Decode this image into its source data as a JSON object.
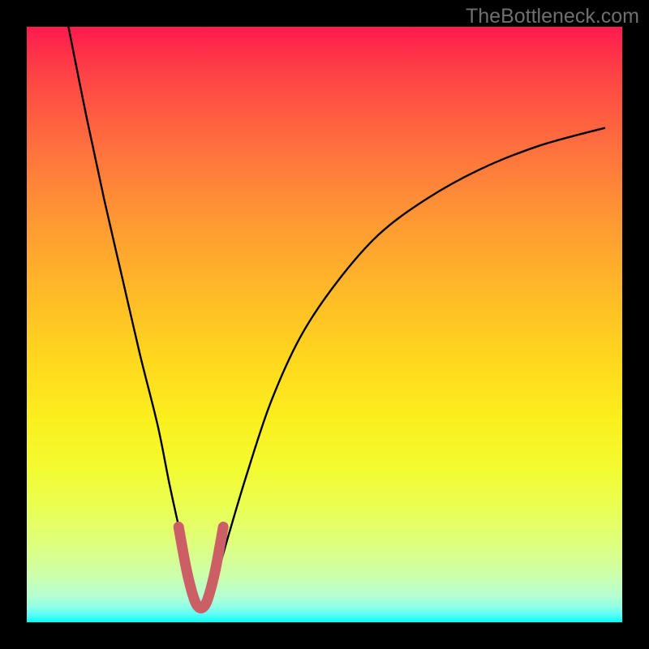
{
  "watermark": "TheBottleneck.com",
  "chart_data": {
    "type": "line",
    "title": "",
    "xlabel": "",
    "ylabel": "",
    "xlim": [
      0,
      100
    ],
    "ylim": [
      0,
      100
    ],
    "series": [
      {
        "name": "main-curve",
        "x": [
          7,
          10,
          13,
          16,
          19,
          22,
          24,
          26,
          27.5,
          29,
          30.5,
          32,
          34,
          37,
          41,
          46,
          52,
          59,
          67,
          76,
          86,
          97
        ],
        "y": [
          100,
          85,
          71,
          58,
          45,
          33,
          23,
          14,
          8,
          3,
          3,
          8,
          15,
          25,
          37,
          48,
          57,
          65,
          71,
          76,
          80,
          83
        ],
        "color": "#000000"
      },
      {
        "name": "highlight-segment",
        "x": [
          25.5,
          27,
          28.5,
          30,
          31.5,
          33
        ],
        "y": [
          16,
          8,
          3,
          3,
          8,
          16
        ],
        "color": "#cc5e66"
      }
    ],
    "gradient": {
      "top": "#fe1a4e",
      "bottom": "#00fff8"
    }
  }
}
